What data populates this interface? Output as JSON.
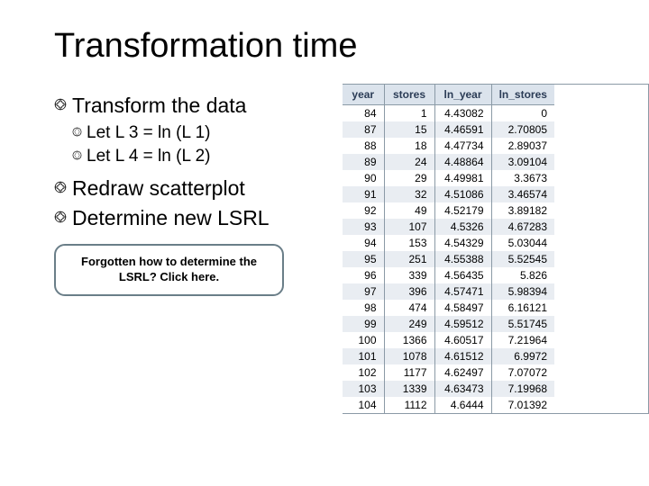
{
  "title": "Transformation time",
  "bullets": {
    "b1": "Transform the data",
    "b1a": "Let L 3 = ln (L 1)",
    "b1b": "Let L 4 = ln (L 2)",
    "b2": "Redraw scatterplot",
    "b3": "Determine new LSRL"
  },
  "callout": "Forgotten how to determine the LSRL?  Click here.",
  "table": {
    "headers": [
      "year",
      "stores",
      "ln_year",
      "ln_stores"
    ],
    "rows": [
      [
        "84",
        "1",
        "4.43082",
        "0"
      ],
      [
        "87",
        "15",
        "4.46591",
        "2.70805"
      ],
      [
        "88",
        "18",
        "4.47734",
        "2.89037"
      ],
      [
        "89",
        "24",
        "4.48864",
        "3.09104"
      ],
      [
        "90",
        "29",
        "4.49981",
        "3.3673"
      ],
      [
        "91",
        "32",
        "4.51086",
        "3.46574"
      ],
      [
        "92",
        "49",
        "4.52179",
        "3.89182"
      ],
      [
        "93",
        "107",
        "4.5326",
        "4.67283"
      ],
      [
        "94",
        "153",
        "4.54329",
        "5.03044"
      ],
      [
        "95",
        "251",
        "4.55388",
        "5.52545"
      ],
      [
        "96",
        "339",
        "4.56435",
        "5.826"
      ],
      [
        "97",
        "396",
        "4.57471",
        "5.98394"
      ],
      [
        "98",
        "474",
        "4.58497",
        "6.16121"
      ],
      [
        "99",
        "249",
        "4.59512",
        "5.51745"
      ],
      [
        "100",
        "1366",
        "4.60517",
        "7.21964"
      ],
      [
        "101",
        "1078",
        "4.61512",
        "6.9972"
      ],
      [
        "102",
        "1177",
        "4.62497",
        "7.07072"
      ],
      [
        "103",
        "1339",
        "4.63473",
        "7.19968"
      ],
      [
        "104",
        "1112",
        "4.6444",
        "7.01392"
      ]
    ]
  },
  "chart_data": {
    "type": "table",
    "columns": [
      "year",
      "stores",
      "ln_year",
      "ln_stores"
    ],
    "rows": [
      {
        "year": 84,
        "stores": 1,
        "ln_year": 4.43082,
        "ln_stores": 0
      },
      {
        "year": 87,
        "stores": 15,
        "ln_year": 4.46591,
        "ln_stores": 2.70805
      },
      {
        "year": 88,
        "stores": 18,
        "ln_year": 4.47734,
        "ln_stores": 2.89037
      },
      {
        "year": 89,
        "stores": 24,
        "ln_year": 4.48864,
        "ln_stores": 3.09104
      },
      {
        "year": 90,
        "stores": 29,
        "ln_year": 4.49981,
        "ln_stores": 3.3673
      },
      {
        "year": 91,
        "stores": 32,
        "ln_year": 4.51086,
        "ln_stores": 3.46574
      },
      {
        "year": 92,
        "stores": 49,
        "ln_year": 4.52179,
        "ln_stores": 3.89182
      },
      {
        "year": 93,
        "stores": 107,
        "ln_year": 4.5326,
        "ln_stores": 4.67283
      },
      {
        "year": 94,
        "stores": 153,
        "ln_year": 4.54329,
        "ln_stores": 5.03044
      },
      {
        "year": 95,
        "stores": 251,
        "ln_year": 4.55388,
        "ln_stores": 5.52545
      },
      {
        "year": 96,
        "stores": 339,
        "ln_year": 4.56435,
        "ln_stores": 5.826
      },
      {
        "year": 97,
        "stores": 396,
        "ln_year": 4.57471,
        "ln_stores": 5.98394
      },
      {
        "year": 98,
        "stores": 474,
        "ln_year": 4.58497,
        "ln_stores": 6.16121
      },
      {
        "year": 99,
        "stores": 249,
        "ln_year": 4.59512,
        "ln_stores": 5.51745
      },
      {
        "year": 100,
        "stores": 1366,
        "ln_year": 4.60517,
        "ln_stores": 7.21964
      },
      {
        "year": 101,
        "stores": 1078,
        "ln_year": 4.61512,
        "ln_stores": 6.9972
      },
      {
        "year": 102,
        "stores": 1177,
        "ln_year": 4.62497,
        "ln_stores": 7.07072
      },
      {
        "year": 103,
        "stores": 1339,
        "ln_year": 4.63473,
        "ln_stores": 7.19968
      },
      {
        "year": 104,
        "stores": 1112,
        "ln_year": 4.6444,
        "ln_stores": 7.01392
      }
    ]
  }
}
